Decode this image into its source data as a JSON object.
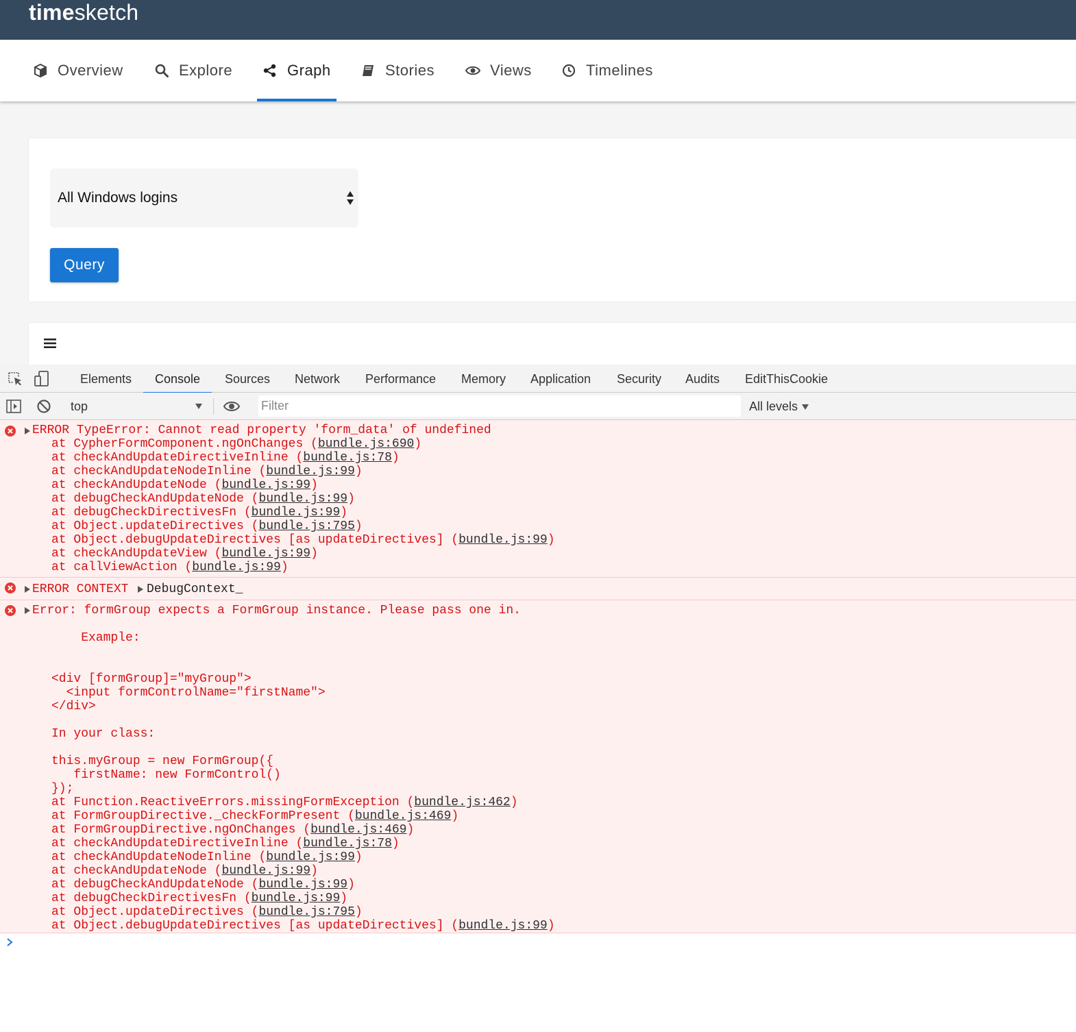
{
  "app": {
    "logo_bold": "time",
    "logo_light": "sketch"
  },
  "nav": {
    "tabs": [
      {
        "label": "Overview",
        "icon": "cube-icon"
      },
      {
        "label": "Explore",
        "icon": "search-icon"
      },
      {
        "label": "Graph",
        "icon": "share-icon",
        "active": true
      },
      {
        "label": "Stories",
        "icon": "book-icon"
      },
      {
        "label": "Views",
        "icon": "eye-icon"
      },
      {
        "label": "Timelines",
        "icon": "clock-icon"
      }
    ]
  },
  "graph": {
    "query_select_value": "All Windows logins",
    "query_button": "Query"
  },
  "devtools": {
    "tabs": [
      "Elements",
      "Console",
      "Sources",
      "Network",
      "Performance",
      "Memory",
      "Application",
      "Security",
      "Audits",
      "EditThisCookie"
    ],
    "active_tab": "Console",
    "context": "top",
    "filter_placeholder": "Filter",
    "levels": "All levels"
  },
  "console": {
    "error1": {
      "message": "ERROR TypeError: Cannot read property 'form_data' of undefined",
      "stack": [
        {
          "text": "at CypherFormComponent.ngOnChanges (",
          "link": "bundle.js:690"
        },
        {
          "text": "at checkAndUpdateDirectiveInline (",
          "link": "bundle.js:78"
        },
        {
          "text": "at checkAndUpdateNodeInline (",
          "link": "bundle.js:99"
        },
        {
          "text": "at checkAndUpdateNode (",
          "link": "bundle.js:99"
        },
        {
          "text": "at debugCheckAndUpdateNode (",
          "link": "bundle.js:99"
        },
        {
          "text": "at debugCheckDirectivesFn (",
          "link": "bundle.js:99"
        },
        {
          "text": "at Object.updateDirectives (",
          "link": "bundle.js:795"
        },
        {
          "text": "at Object.debugUpdateDirectives [as updateDirectives] (",
          "link": "bundle.js:99"
        },
        {
          "text": "at checkAndUpdateView (",
          "link": "bundle.js:99"
        },
        {
          "text": "at callViewAction (",
          "link": "bundle.js:99"
        }
      ]
    },
    "error2": {
      "label": "ERROR CONTEXT",
      "object": "DebugContext_"
    },
    "error3": {
      "message": "Error: formGroup expects a FormGroup instance. Please pass one in.",
      "body": [
        "    Example:",
        "",
        "",
        "<div [formGroup]=\"myGroup\">",
        "  <input formControlName=\"firstName\">",
        "</div>",
        "",
        "In your class:",
        "",
        "this.myGroup = new FormGroup({",
        "   firstName: new FormControl()",
        "});"
      ],
      "stack": [
        {
          "text": "at Function.ReactiveErrors.missingFormException (",
          "link": "bundle.js:462"
        },
        {
          "text": "at FormGroupDirective._checkFormPresent (",
          "link": "bundle.js:469"
        },
        {
          "text": "at FormGroupDirective.ngOnChanges (",
          "link": "bundle.js:469"
        },
        {
          "text": "at checkAndUpdateDirectiveInline (",
          "link": "bundle.js:78"
        },
        {
          "text": "at checkAndUpdateNodeInline (",
          "link": "bundle.js:99"
        },
        {
          "text": "at checkAndUpdateNode (",
          "link": "bundle.js:99"
        },
        {
          "text": "at debugCheckAndUpdateNode (",
          "link": "bundle.js:99"
        },
        {
          "text": "at debugCheckDirectivesFn (",
          "link": "bundle.js:99"
        },
        {
          "text": "at Object.updateDirectives (",
          "link": "bundle.js:795"
        },
        {
          "text": "at Object.debugUpdateDirectives [as updateDirectives] (",
          "link": "bundle.js:99"
        }
      ]
    },
    "closing_paren": ")"
  },
  "colors": {
    "header_bg": "#34495e",
    "accent": "#1976d2",
    "error_text": "#d61313",
    "error_bg": "#fff0f0"
  }
}
